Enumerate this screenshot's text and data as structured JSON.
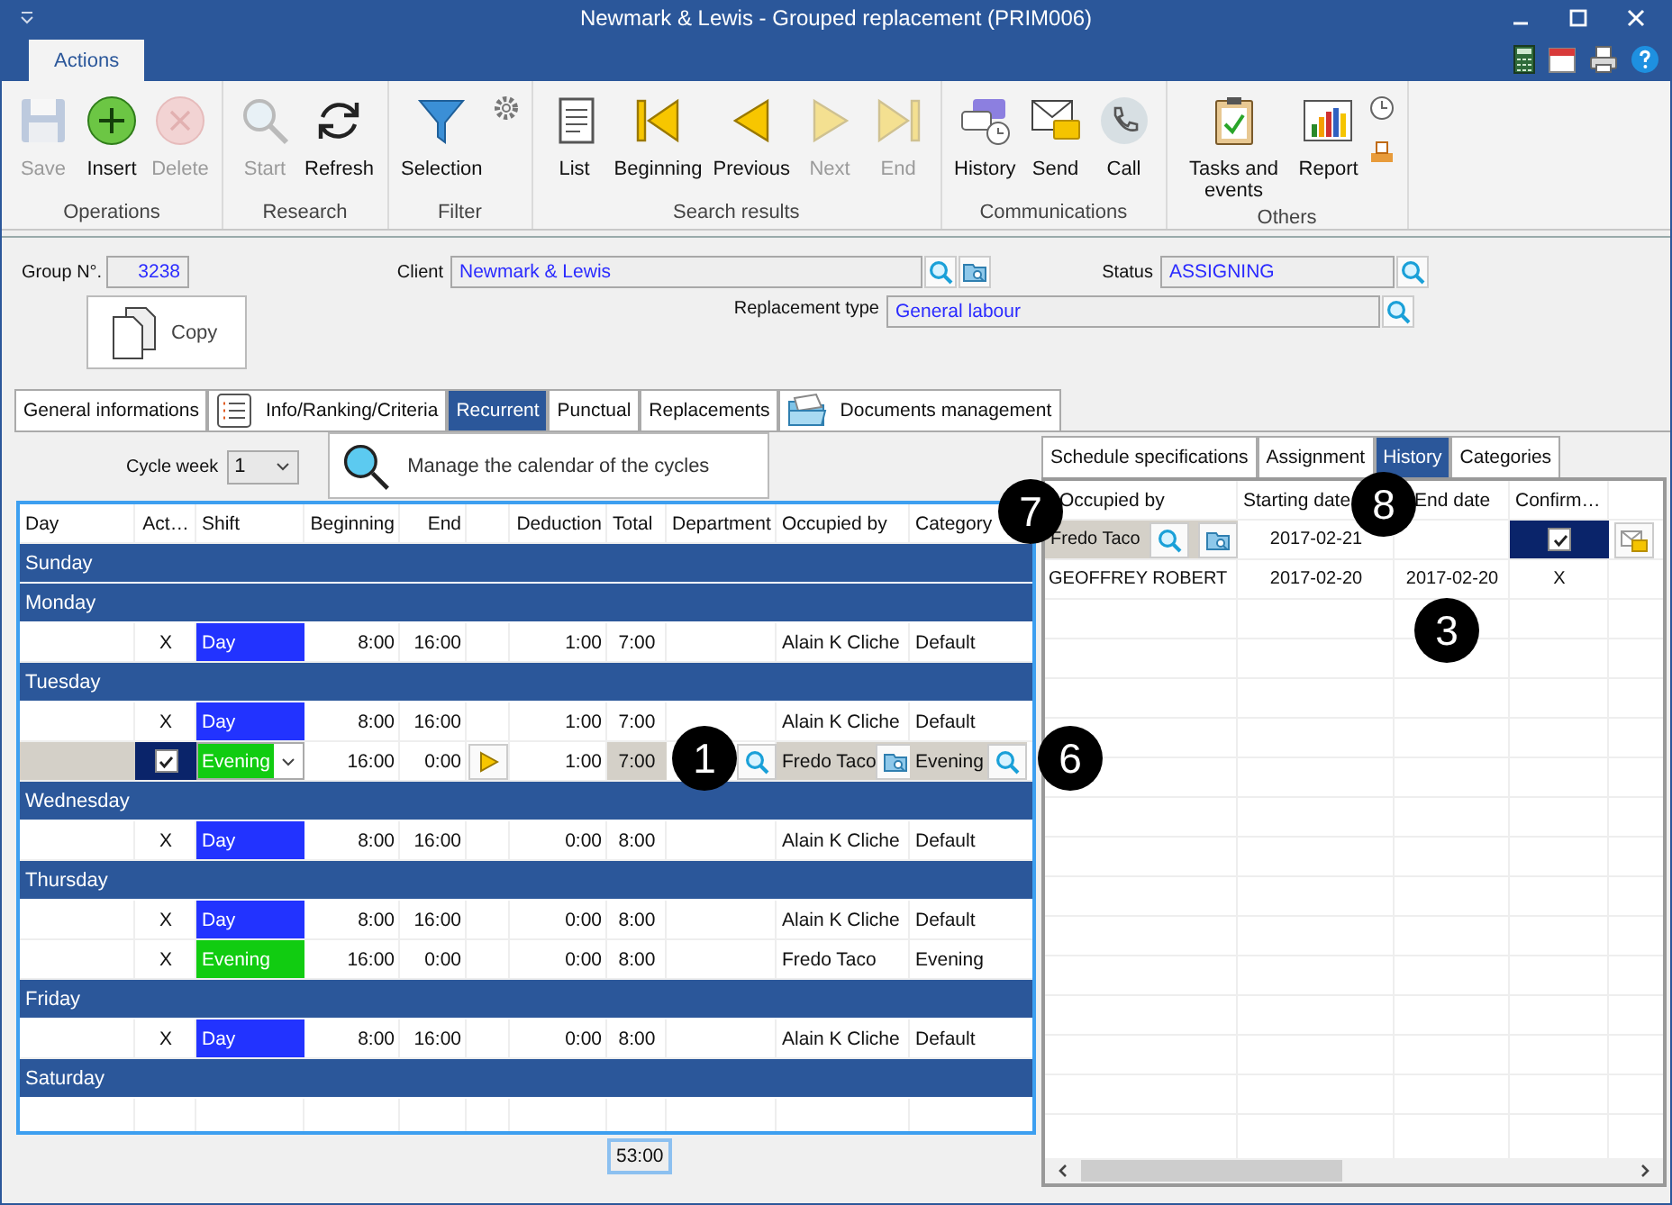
{
  "window": {
    "title": "Newmark & Lewis - Grouped replacement (PRIM006)"
  },
  "ribbon": {
    "tabs": [
      {
        "label": "Actions",
        "selected": true
      }
    ],
    "groups": [
      {
        "label": "Operations",
        "buttons": [
          {
            "kind": "save",
            "label": "Save",
            "disabled": true
          },
          {
            "kind": "insert",
            "label": "Insert",
            "disabled": false
          },
          {
            "kind": "delete",
            "label": "Delete",
            "disabled": true
          }
        ]
      },
      {
        "label": "Research",
        "buttons": [
          {
            "kind": "search",
            "label": "Start",
            "disabled": true
          },
          {
            "kind": "refresh",
            "label": "Refresh",
            "disabled": false
          }
        ]
      },
      {
        "label": "Filter",
        "buttons": [
          {
            "kind": "funnel",
            "label": "Selection",
            "disabled": false
          },
          {
            "kind": "gear",
            "disabled": false
          }
        ]
      },
      {
        "label": "Search results",
        "buttons": [
          {
            "kind": "list",
            "label": "List",
            "disabled": false
          },
          {
            "kind": "beginning",
            "label": "Beginning",
            "disabled": false
          },
          {
            "kind": "previous",
            "label": "Previous",
            "disabled": false
          },
          {
            "kind": "next",
            "label": "Next",
            "disabled": true
          },
          {
            "kind": "end",
            "label": "End",
            "disabled": true
          }
        ]
      },
      {
        "label": "Communications",
        "buttons": [
          {
            "kind": "history",
            "label": "History",
            "disabled": false
          },
          {
            "kind": "send",
            "label": "Send",
            "disabled": false
          },
          {
            "kind": "call",
            "label": "Call",
            "disabled": false
          }
        ]
      },
      {
        "label": "Others",
        "buttons": [
          {
            "kind": "tasks",
            "label": "Tasks and events",
            "disabled": false
          },
          {
            "kind": "report",
            "label": "Report",
            "disabled": false
          },
          {
            "kind": "clock",
            "disabled": false
          },
          {
            "kind": "tray",
            "disabled": false
          }
        ]
      }
    ]
  },
  "form": {
    "group_no": {
      "label": "Group N°.",
      "value": "3238"
    },
    "client": {
      "label": "Client",
      "value": "Newmark & Lewis"
    },
    "status": {
      "label": "Status",
      "value": "ASSIGNING"
    },
    "copy_button": {
      "label": "Copy"
    },
    "replacement_type": {
      "label": "Replacement type",
      "value": "General labour"
    }
  },
  "tabs": [
    {
      "label": "General informations",
      "kind": "plain",
      "selected": false
    },
    {
      "label": "Info/Ranking/Criteria",
      "kind": "list",
      "selected": false
    },
    {
      "label": "Recurrent",
      "kind": "plain",
      "selected": true
    },
    {
      "label": "Punctual",
      "kind": "plain",
      "selected": false
    },
    {
      "label": "Replacements",
      "kind": "plain",
      "selected": false
    },
    {
      "label": "Documents management",
      "kind": "folder",
      "selected": false
    }
  ],
  "recurrent": {
    "cycle_week": {
      "label": "Cycle week",
      "value": "1"
    },
    "calendar_button": {
      "label": "Manage the calendar of the cycles"
    },
    "columns": [
      "Day",
      "Act…",
      "Shift",
      "Beginning",
      "End",
      "Deduction",
      "Total",
      "Department",
      "Occupied by",
      "Category"
    ],
    "rows": [
      {
        "kind": "day",
        "label": "Sunday"
      },
      {
        "kind": "day",
        "label": "Monday"
      },
      {
        "kind": "shift",
        "active": "X",
        "shift": "Day",
        "color": "#2233ff",
        "beginning": "8:00",
        "end": "16:00",
        "deduction": "1:00",
        "total": "7:00",
        "occupied_by": "Alain K Cliche",
        "category": "Default"
      },
      {
        "kind": "day",
        "label": "Tuesday"
      },
      {
        "kind": "shift",
        "active": "X",
        "shift": "Day",
        "color": "#2233ff",
        "beginning": "8:00",
        "end": "16:00",
        "deduction": "1:00",
        "total": "7:00",
        "occupied_by": "Alain K Cliche",
        "category": "Default"
      },
      {
        "kind": "edit",
        "checked": true,
        "shift": "Evening",
        "color": "#11cc11",
        "beginning": "16:00",
        "end": "0:00",
        "deduction": "1:00",
        "total": "7:00",
        "occupied_by": "Fredo Taco",
        "category": "Evening"
      },
      {
        "kind": "day",
        "label": "Wednesday"
      },
      {
        "kind": "shift",
        "active": "X",
        "shift": "Day",
        "color": "#2233ff",
        "beginning": "8:00",
        "end": "16:00",
        "deduction": "0:00",
        "total": "8:00",
        "occupied_by": "Alain K Cliche",
        "category": "Default"
      },
      {
        "kind": "day",
        "label": "Thursday"
      },
      {
        "kind": "shift",
        "active": "X",
        "shift": "Day",
        "color": "#2233ff",
        "beginning": "8:00",
        "end": "16:00",
        "deduction": "0:00",
        "total": "8:00",
        "occupied_by": "Alain K Cliche",
        "category": "Default"
      },
      {
        "kind": "shift",
        "active": "X",
        "shift": "Evening",
        "color": "#11cc11",
        "beginning": "16:00",
        "end": "0:00",
        "deduction": "0:00",
        "total": "8:00",
        "occupied_by": "Fredo Taco",
        "category": "Evening"
      },
      {
        "kind": "day",
        "label": "Friday"
      },
      {
        "kind": "shift",
        "active": "X",
        "shift": "Day",
        "color": "#2233ff",
        "beginning": "8:00",
        "end": "16:00",
        "deduction": "0:00",
        "total": "8:00",
        "occupied_by": "Alain K Cliche",
        "category": "Default"
      },
      {
        "kind": "day",
        "label": "Saturday"
      }
    ],
    "total": "53:00"
  },
  "detail": {
    "tabs": [
      {
        "label": "Schedule specifications",
        "selected": false
      },
      {
        "label": "Assignment",
        "selected": false
      },
      {
        "label": "History",
        "selected": true
      },
      {
        "label": "Categories",
        "selected": false
      }
    ],
    "columns": [
      "Occupied by",
      "Starting date",
      "End date",
      "Confirm…"
    ],
    "rows": [
      {
        "kind": "edit",
        "occupied_by": "Fredo Taco",
        "starting_date": "2017-02-21",
        "checked": true
      },
      {
        "kind": "plain",
        "occupied_by": "GEOFFREY ROBERT",
        "starting_date": "2017-02-20",
        "end_date": "2017-02-20",
        "confirmed": "X"
      }
    ]
  },
  "callouts": [
    "1",
    "6",
    "7",
    "8",
    "3"
  ]
}
